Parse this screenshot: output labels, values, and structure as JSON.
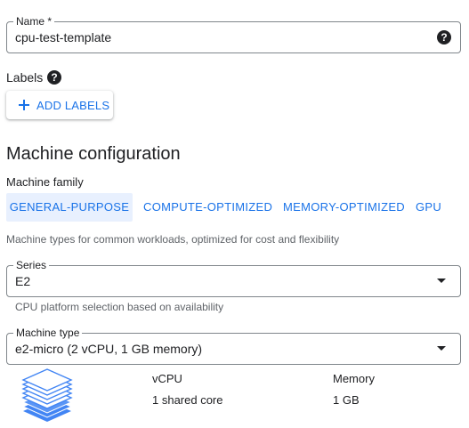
{
  "name_field": {
    "label": "Name *",
    "value": "cpu-test-template",
    "help_icon": "help-circle-icon"
  },
  "labels": {
    "title": "Labels",
    "help_icon": "help-circle-icon",
    "add_button": "ADD LABELS"
  },
  "machine_config": {
    "title": "Machine configuration",
    "family_title": "Machine family",
    "tabs": [
      {
        "label": "GENERAL-PURPOSE",
        "active": true
      },
      {
        "label": "COMPUTE-OPTIMIZED",
        "active": false
      },
      {
        "label": "MEMORY-OPTIMIZED",
        "active": false
      },
      {
        "label": "GPU",
        "active": false
      }
    ],
    "family_description": "Machine types for common workloads, optimized for cost and flexibility",
    "series": {
      "label": "Series",
      "value": "E2",
      "hint": "CPU platform selection based on availability"
    },
    "machine_type": {
      "label": "Machine type",
      "value": "e2-micro (2 vCPU, 1 GB memory)"
    },
    "stats": [
      {
        "header": "vCPU",
        "value": "1 shared core"
      },
      {
        "header": "Memory",
        "value": "1 GB"
      }
    ],
    "stack_icon": "layers-stack-icon"
  },
  "colors": {
    "accent": "#1a73e8",
    "tab_active_bg": "#e8f0fe",
    "text": "#202124",
    "muted": "#5f6368",
    "border": "#80868b",
    "icon_blue": "#4285f4"
  }
}
